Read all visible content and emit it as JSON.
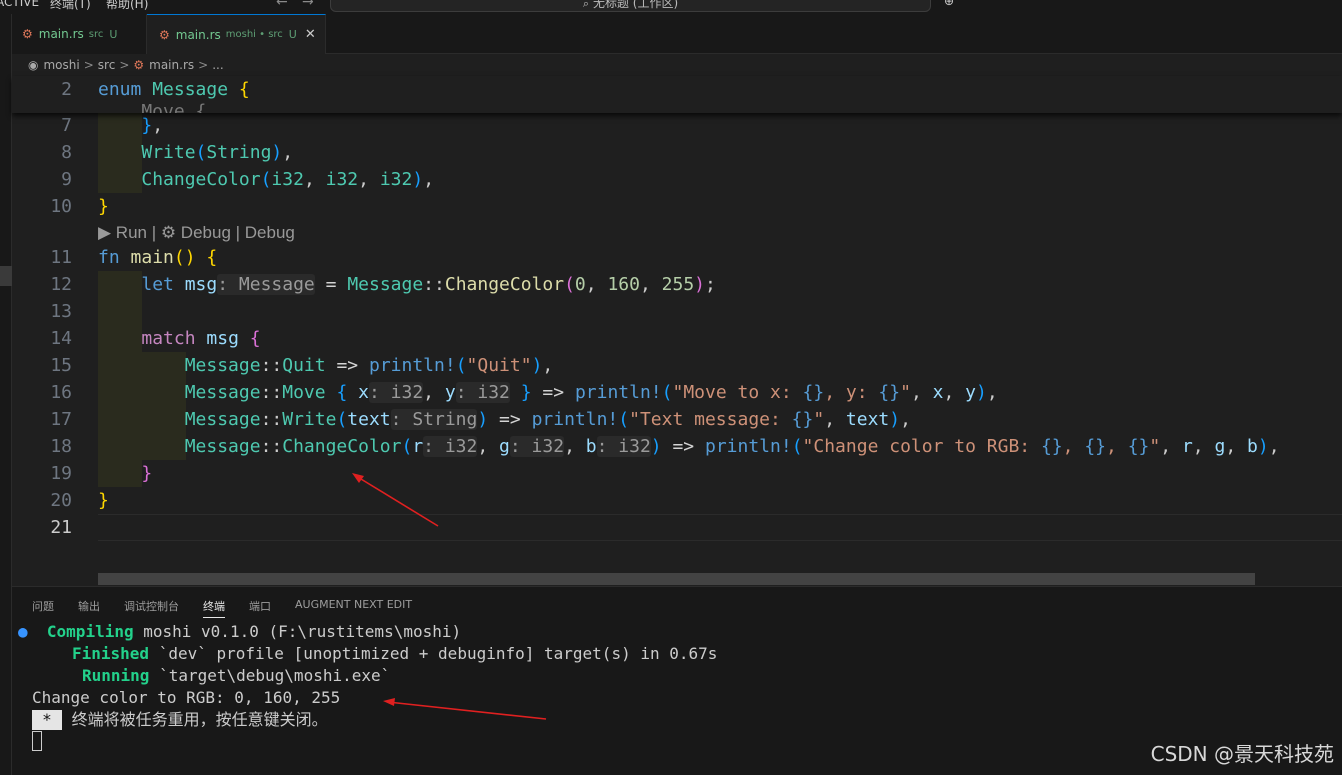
{
  "menu": {
    "items": [
      "ACTIVE",
      "终端(T)",
      "帮助(H)"
    ],
    "command_center": "无标题 (工作区)",
    "back": "←",
    "forward": "→",
    "account": "⊕ ˅"
  },
  "tabs": [
    {
      "name": "main.rs",
      "desc": "src",
      "status": "U"
    },
    {
      "name": "main.rs",
      "desc": "moshi • src",
      "status": "U",
      "close": "✕"
    }
  ],
  "breadcrumb": {
    "items": [
      "moshi",
      "src",
      "main.rs",
      "..."
    ],
    "sep": ">"
  },
  "editor": {
    "sticky": {
      "line": "2",
      "text": "enum Message {"
    },
    "line_numbers": [
      "7",
      "8",
      "9",
      "10",
      "11",
      "12",
      "13",
      "14",
      "15",
      "16",
      "17",
      "18",
      "19",
      "20",
      "21"
    ],
    "current_line": "21",
    "codelens": "▶ Run | ⚙ Debug | Debug"
  },
  "panel": {
    "tabs": [
      "问题",
      "输出",
      "调试控制台",
      "终端",
      "端口",
      "AUGMENT NEXT EDIT"
    ],
    "active_tab": "终端",
    "terminal": {
      "line1_label": "Compiling",
      "line1_text": " moshi v0.1.0 (F:\\rustitems\\moshi)",
      "line2_label": "Finished",
      "line2_text": " `dev` profile [unoptimized + debuginfo] target(s) in 0.67s",
      "line3_label": "Running",
      "line3_text": " `target\\debug\\moshi.exe`",
      "output": "Change color to RGB: 0, 160, 255",
      "star": "*",
      "reuse_msg": " 终端将被任务重用，按任意键关闭。"
    }
  },
  "watermark": "CSDN @景天科技苑",
  "colors": {
    "accent": "#0078d4",
    "arrow": "#e02020",
    "terminal_green": "#23d18b"
  }
}
